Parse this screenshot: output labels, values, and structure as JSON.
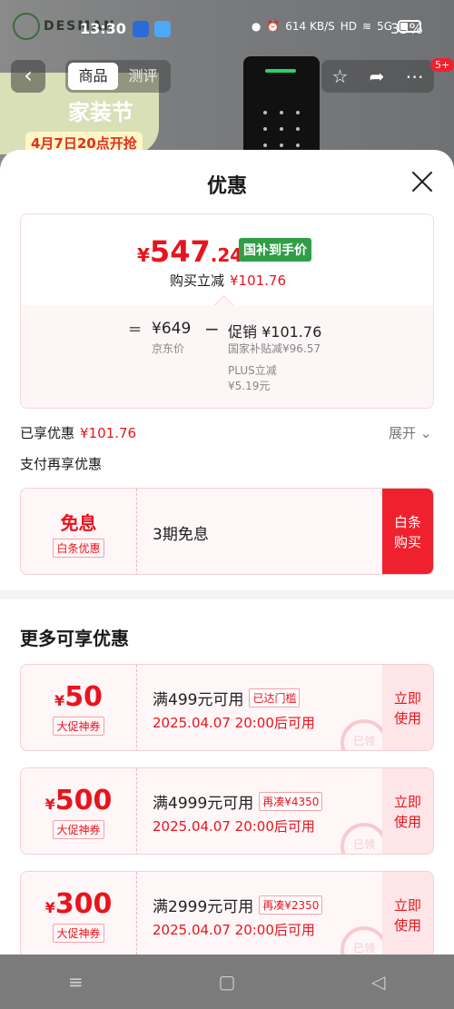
{
  "status_bar": {
    "brand": "DESMAN",
    "time": "13:30",
    "net": "614 KB/S",
    "hd": "HD",
    "signal": "5G",
    "battery": "35%"
  },
  "header": {
    "back_icon": "back-arrow-icon",
    "tabs": [
      "商品",
      "测评"
    ],
    "badge": "5+"
  },
  "banner": {
    "line1": "家装节",
    "line2": "4月7日20点开抢"
  },
  "sheet": {
    "title": "优惠",
    "final_price": {
      "currency": "¥",
      "integer": "547",
      "decimal": ".24",
      "tag": "国补到手价"
    },
    "buy_cut_label": "购买立减",
    "buy_cut_value": "¥101.76",
    "breakdown": {
      "eq": "=",
      "jd_price": "¥649",
      "jd_label": "京东价",
      "minus": "−",
      "promo": "促销 ¥101.76",
      "sub1": "国家补贴减¥96.57",
      "sub2": "PLUS立减",
      "sub3": "¥5.19元"
    },
    "enjoyed_label": "已享优惠",
    "enjoyed_value": "¥101.76",
    "expand_label": "展开",
    "pay_more_label": "支付再享优惠",
    "baitiao": {
      "title": "免息",
      "pill": "白条优惠",
      "desc": "3期免息",
      "button_l1": "白条",
      "button_l2": "购买"
    },
    "more_title": "更多可享优惠",
    "coupons": [
      {
        "cur": "¥",
        "amount": "50",
        "pill": "大促神券",
        "cond": "满499元可用",
        "tag": "已达门槛",
        "time": "2025.04.07 20:00后可用",
        "btn1": "立即",
        "btn2": "使用",
        "stamp": "已领"
      },
      {
        "cur": "¥",
        "amount": "500",
        "pill": "大促神券",
        "cond": "满4999元可用",
        "tag": "再凑¥4350",
        "time": "2025.04.07 20:00后可用",
        "btn1": "立即",
        "btn2": "使用",
        "stamp": "已领"
      },
      {
        "cur": "¥",
        "amount": "300",
        "pill": "大促神券",
        "cond": "满2999元可用",
        "tag": "再凑¥2350",
        "time": "2025.04.07 20:00后可用",
        "btn1": "立即",
        "btn2": "使用",
        "stamp": "已领"
      }
    ]
  },
  "nav": {
    "menu_icon": "≡",
    "home_icon": "▢",
    "back_icon": "◁"
  }
}
